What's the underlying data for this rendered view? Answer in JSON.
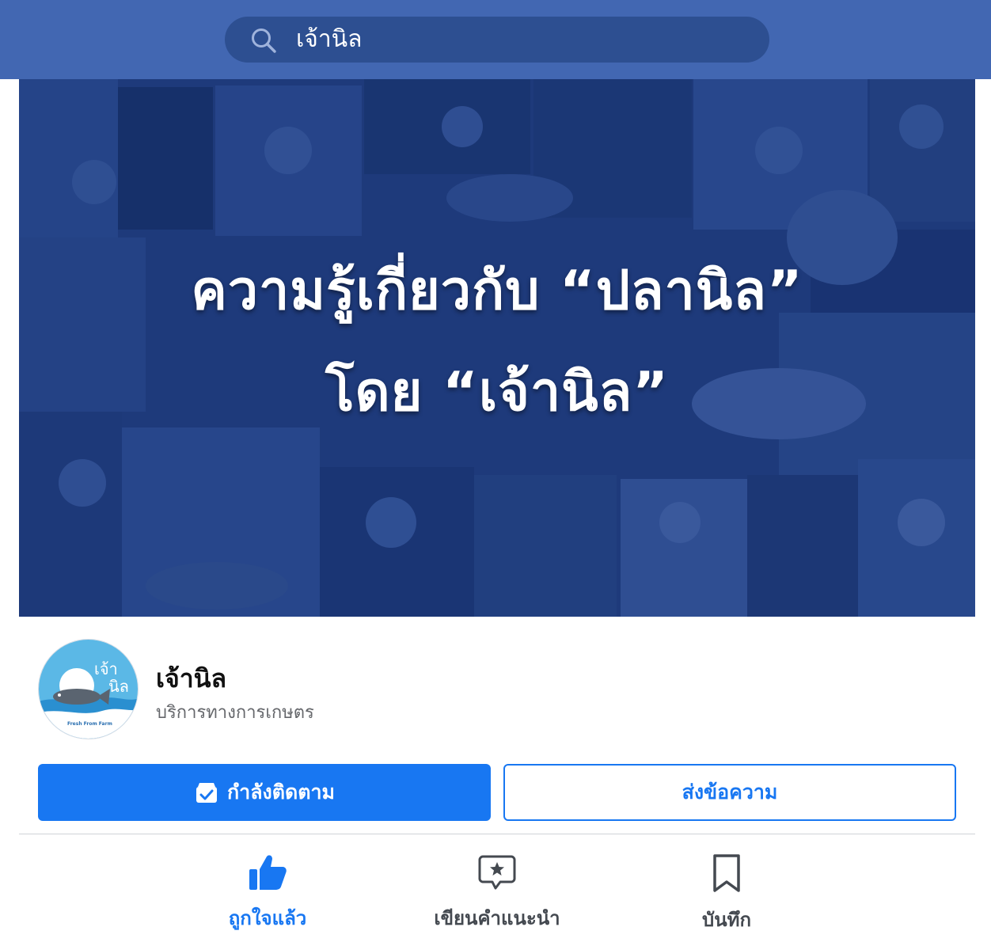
{
  "search": {
    "query": "เจ้านิล"
  },
  "cover": {
    "line1": "ความรู้เกี่ยวกับ “ปลานิล”",
    "line2": "โดย “เจ้านิล”"
  },
  "profile": {
    "logo_text_top": "เจ้า",
    "logo_text_bottom": "นิล",
    "logo_tagline": "Fresh From Farm",
    "name": "เจ้านิล",
    "category": "บริการทางการเกษตร"
  },
  "buttons": {
    "following": "กำลังติดตาม",
    "message": "ส่งข้อความ"
  },
  "actions": {
    "liked": "ถูกใจแล้ว",
    "recommend": "เขียนคำแนะนำ",
    "save": "บันทึก"
  },
  "colors": {
    "header": "#4267b2",
    "primary": "#1877f2",
    "cover_tint": "#203c7a"
  }
}
